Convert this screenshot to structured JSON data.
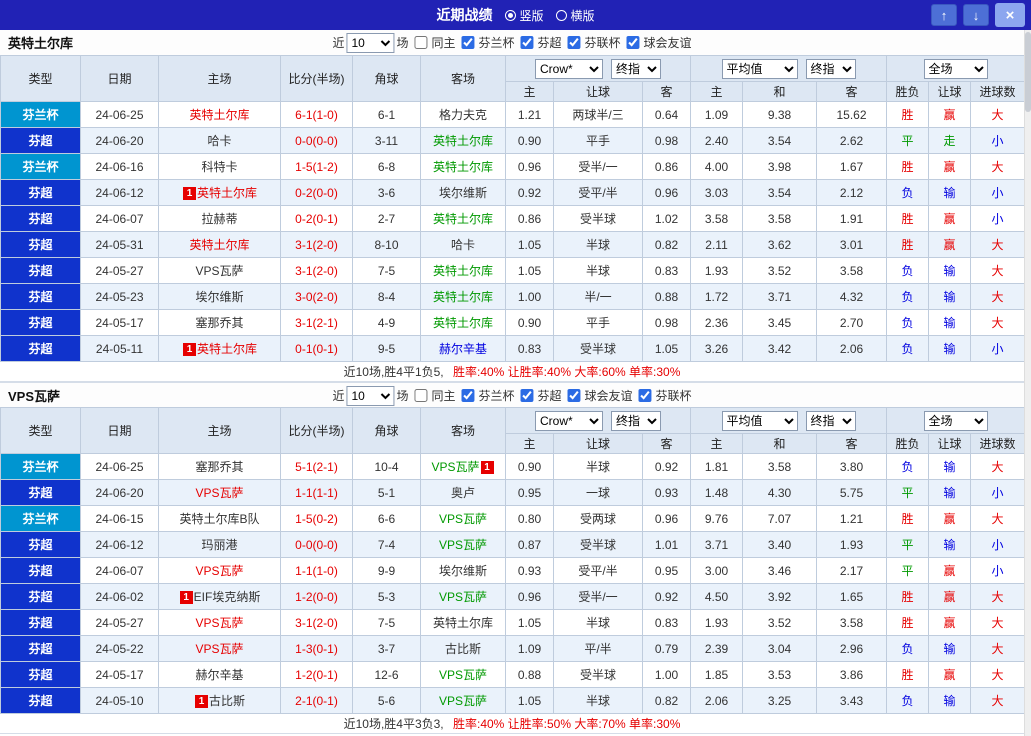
{
  "titlebar": {
    "title": "近期战绩",
    "vertical_label": "竖版",
    "horizontal_label": "横版",
    "vertical_selected": true,
    "up_icon": "↑",
    "down_icon": "↓",
    "close_icon": "×"
  },
  "filter_labels": {
    "near": "近",
    "matches": "场",
    "same_home": "同主"
  },
  "table_headers": {
    "type": "类型",
    "date": "日期",
    "home": "主场",
    "score": "比分(半场)",
    "corners": "角球",
    "away": "客场",
    "odds_home": "主",
    "handicap": "让球",
    "odds_away": "客",
    "avg_home": "主",
    "avg_draw": "和",
    "avg_away": "客",
    "result": "胜负",
    "handicap_result": "让球",
    "goals": "进球数"
  },
  "colors": {
    "titlebar_bg": "#2122b5",
    "leagues": {
      "芬兰杯": "#0095d0",
      "芬超": "#1033cc"
    },
    "text": {
      "red": "#e60000",
      "green": "#009900",
      "blue": "#0000e0",
      "black": "#333333"
    }
  },
  "sections": [
    {
      "team": "英特土尔库",
      "selects": {
        "count": "10",
        "provider": "Crow*",
        "provider_stage": "终指",
        "avg": "平均值",
        "avg_stage": "终指",
        "scope": "全场"
      },
      "same_home_checked": false,
      "filters": [
        {
          "label": "芬兰杯",
          "checked": true
        },
        {
          "label": "芬超",
          "checked": true
        },
        {
          "label": "芬联杯",
          "checked": true
        },
        {
          "label": "球会友谊",
          "checked": true
        }
      ],
      "rows": [
        {
          "league": "芬兰杯",
          "date": "24-06-25",
          "home": {
            "name": "英特土尔库",
            "color": "red"
          },
          "score": "6-1(1-0)",
          "corners": "6-1",
          "away": {
            "name": "格力夫克",
            "color": "black"
          },
          "odds": [
            "1.21",
            "两球半/三",
            "0.64"
          ],
          "avg": [
            "1.09",
            "9.38",
            "15.62"
          ],
          "results": [
            [
              "胜",
              "red"
            ],
            [
              "赢",
              "red"
            ],
            [
              "大",
              "red"
            ]
          ]
        },
        {
          "league": "芬超",
          "date": "24-06-20",
          "home": {
            "name": "哈卡",
            "color": "black"
          },
          "score": "0-0(0-0)",
          "corners": "3-11",
          "away": {
            "name": "英特土尔库",
            "color": "green"
          },
          "odds": [
            "0.90",
            "平手",
            "0.98"
          ],
          "avg": [
            "2.40",
            "3.54",
            "2.62"
          ],
          "results": [
            [
              "平",
              "green"
            ],
            [
              "走",
              "green"
            ],
            [
              "小",
              "blue"
            ]
          ]
        },
        {
          "league": "芬兰杯",
          "date": "24-06-16",
          "home": {
            "name": "科特卡",
            "color": "black"
          },
          "score": "1-5(1-2)",
          "corners": "6-8",
          "away": {
            "name": "英特土尔库",
            "color": "green"
          },
          "odds": [
            "0.96",
            "受半/一",
            "0.86"
          ],
          "avg": [
            "4.00",
            "3.98",
            "1.67"
          ],
          "results": [
            [
              "胜",
              "red"
            ],
            [
              "赢",
              "red"
            ],
            [
              "大",
              "red"
            ]
          ]
        },
        {
          "league": "芬超",
          "date": "24-06-12",
          "home": {
            "name": "英特土尔库",
            "color": "red",
            "badge": "1"
          },
          "score": "0-2(0-0)",
          "corners": "3-6",
          "away": {
            "name": "埃尔维斯",
            "color": "black"
          },
          "odds": [
            "0.92",
            "受平/半",
            "0.96"
          ],
          "avg": [
            "3.03",
            "3.54",
            "2.12"
          ],
          "results": [
            [
              "负",
              "blue"
            ],
            [
              "输",
              "blue"
            ],
            [
              "小",
              "blue"
            ]
          ]
        },
        {
          "league": "芬超",
          "date": "24-06-07",
          "home": {
            "name": "拉赫蒂",
            "color": "black"
          },
          "score": "0-2(0-1)",
          "corners": "2-7",
          "away": {
            "name": "英特土尔库",
            "color": "green"
          },
          "odds": [
            "0.86",
            "受半球",
            "1.02"
          ],
          "avg": [
            "3.58",
            "3.58",
            "1.91"
          ],
          "results": [
            [
              "胜",
              "red"
            ],
            [
              "赢",
              "red"
            ],
            [
              "小",
              "blue"
            ]
          ]
        },
        {
          "league": "芬超",
          "date": "24-05-31",
          "home": {
            "name": "英特土尔库",
            "color": "red"
          },
          "score": "3-1(2-0)",
          "corners": "8-10",
          "away": {
            "name": "哈卡",
            "color": "black"
          },
          "odds": [
            "1.05",
            "半球",
            "0.82"
          ],
          "avg": [
            "2.11",
            "3.62",
            "3.01"
          ],
          "results": [
            [
              "胜",
              "red"
            ],
            [
              "赢",
              "red"
            ],
            [
              "大",
              "red"
            ]
          ]
        },
        {
          "league": "芬超",
          "date": "24-05-27",
          "home": {
            "name": "VPS瓦萨",
            "color": "black"
          },
          "score": "3-1(2-0)",
          "corners": "7-5",
          "away": {
            "name": "英特土尔库",
            "color": "green"
          },
          "odds": [
            "1.05",
            "半球",
            "0.83"
          ],
          "avg": [
            "1.93",
            "3.52",
            "3.58"
          ],
          "results": [
            [
              "负",
              "blue"
            ],
            [
              "输",
              "blue"
            ],
            [
              "大",
              "red"
            ]
          ]
        },
        {
          "league": "芬超",
          "date": "24-05-23",
          "home": {
            "name": "埃尔维斯",
            "color": "black"
          },
          "score": "3-0(2-0)",
          "corners": "8-4",
          "away": {
            "name": "英特土尔库",
            "color": "green"
          },
          "odds": [
            "1.00",
            "半/一",
            "0.88"
          ],
          "avg": [
            "1.72",
            "3.71",
            "4.32"
          ],
          "results": [
            [
              "负",
              "blue"
            ],
            [
              "输",
              "blue"
            ],
            [
              "大",
              "red"
            ]
          ]
        },
        {
          "league": "芬超",
          "date": "24-05-17",
          "home": {
            "name": "塞那乔其",
            "color": "black"
          },
          "score": "3-1(2-1)",
          "corners": "4-9",
          "away": {
            "name": "英特土尔库",
            "color": "green"
          },
          "odds": [
            "0.90",
            "平手",
            "0.98"
          ],
          "avg": [
            "2.36",
            "3.45",
            "2.70"
          ],
          "results": [
            [
              "负",
              "blue"
            ],
            [
              "输",
              "blue"
            ],
            [
              "大",
              "red"
            ]
          ]
        },
        {
          "league": "芬超",
          "date": "24-05-11",
          "home": {
            "name": "英特土尔库",
            "color": "red",
            "badge": "1"
          },
          "score": "0-1(0-1)",
          "corners": "9-5",
          "away": {
            "name": "赫尔辛基",
            "color": "blue"
          },
          "odds": [
            "0.83",
            "受半球",
            "1.05"
          ],
          "avg": [
            "3.26",
            "3.42",
            "2.06"
          ],
          "results": [
            [
              "负",
              "blue"
            ],
            [
              "输",
              "blue"
            ],
            [
              "小",
              "blue"
            ]
          ]
        }
      ],
      "summary_prefix": "近10场,胜4平1负5,",
      "summary_stats": "胜率:40% 让胜率:40% 大率:60% 单率:30%"
    },
    {
      "team": "VPS瓦萨",
      "selects": {
        "count": "10",
        "provider": "Crow*",
        "provider_stage": "终指",
        "avg": "平均值",
        "avg_stage": "终指",
        "scope": "全场"
      },
      "same_home_checked": false,
      "filters": [
        {
          "label": "芬兰杯",
          "checked": true
        },
        {
          "label": "芬超",
          "checked": true
        },
        {
          "label": "球会友谊",
          "checked": true
        },
        {
          "label": "芬联杯",
          "checked": true
        }
      ],
      "rows": [
        {
          "league": "芬兰杯",
          "date": "24-06-25",
          "home": {
            "name": "塞那乔其",
            "color": "black"
          },
          "score": "5-1(2-1)",
          "corners": "10-4",
          "away": {
            "name": "VPS瓦萨",
            "color": "green",
            "badge": "1",
            "badge_after": true
          },
          "odds": [
            "0.90",
            "半球",
            "0.92"
          ],
          "avg": [
            "1.81",
            "3.58",
            "3.80"
          ],
          "results": [
            [
              "负",
              "blue"
            ],
            [
              "输",
              "blue"
            ],
            [
              "大",
              "red"
            ]
          ]
        },
        {
          "league": "芬超",
          "date": "24-06-20",
          "home": {
            "name": "VPS瓦萨",
            "color": "red"
          },
          "score": "1-1(1-1)",
          "corners": "5-1",
          "away": {
            "name": "奥卢",
            "color": "black"
          },
          "odds": [
            "0.95",
            "一球",
            "0.93"
          ],
          "avg": [
            "1.48",
            "4.30",
            "5.75"
          ],
          "results": [
            [
              "平",
              "green"
            ],
            [
              "输",
              "blue"
            ],
            [
              "小",
              "blue"
            ]
          ]
        },
        {
          "league": "芬兰杯",
          "date": "24-06-15",
          "home": {
            "name": "英特土尔库B队",
            "color": "black"
          },
          "score": "1-5(0-2)",
          "corners": "6-6",
          "away": {
            "name": "VPS瓦萨",
            "color": "green"
          },
          "odds": [
            "0.80",
            "受两球",
            "0.96"
          ],
          "avg": [
            "9.76",
            "7.07",
            "1.21"
          ],
          "results": [
            [
              "胜",
              "red"
            ],
            [
              "赢",
              "red"
            ],
            [
              "大",
              "red"
            ]
          ]
        },
        {
          "league": "芬超",
          "date": "24-06-12",
          "home": {
            "name": "玛丽港",
            "color": "black"
          },
          "score": "0-0(0-0)",
          "corners": "7-4",
          "away": {
            "name": "VPS瓦萨",
            "color": "green"
          },
          "odds": [
            "0.87",
            "受半球",
            "1.01"
          ],
          "avg": [
            "3.71",
            "3.40",
            "1.93"
          ],
          "results": [
            [
              "平",
              "green"
            ],
            [
              "输",
              "blue"
            ],
            [
              "小",
              "blue"
            ]
          ]
        },
        {
          "league": "芬超",
          "date": "24-06-07",
          "home": {
            "name": "VPS瓦萨",
            "color": "red"
          },
          "score": "1-1(1-0)",
          "corners": "9-9",
          "away": {
            "name": "埃尔维斯",
            "color": "black"
          },
          "odds": [
            "0.93",
            "受平/半",
            "0.95"
          ],
          "avg": [
            "3.00",
            "3.46",
            "2.17"
          ],
          "results": [
            [
              "平",
              "green"
            ],
            [
              "赢",
              "red"
            ],
            [
              "小",
              "blue"
            ]
          ]
        },
        {
          "league": "芬超",
          "date": "24-06-02",
          "home": {
            "name": "EIF埃克纳斯",
            "color": "black",
            "badge": "1"
          },
          "score": "1-2(0-0)",
          "corners": "5-3",
          "away": {
            "name": "VPS瓦萨",
            "color": "green"
          },
          "odds": [
            "0.96",
            "受半/一",
            "0.92"
          ],
          "avg": [
            "4.50",
            "3.92",
            "1.65"
          ],
          "results": [
            [
              "胜",
              "red"
            ],
            [
              "赢",
              "red"
            ],
            [
              "大",
              "red"
            ]
          ]
        },
        {
          "league": "芬超",
          "date": "24-05-27",
          "home": {
            "name": "VPS瓦萨",
            "color": "red"
          },
          "score": "3-1(2-0)",
          "corners": "7-5",
          "away": {
            "name": "英特土尔库",
            "color": "black"
          },
          "odds": [
            "1.05",
            "半球",
            "0.83"
          ],
          "avg": [
            "1.93",
            "3.52",
            "3.58"
          ],
          "results": [
            [
              "胜",
              "red"
            ],
            [
              "赢",
              "red"
            ],
            [
              "大",
              "red"
            ]
          ]
        },
        {
          "league": "芬超",
          "date": "24-05-22",
          "home": {
            "name": "VPS瓦萨",
            "color": "red"
          },
          "score": "1-3(0-1)",
          "corners": "3-7",
          "away": {
            "name": "古比斯",
            "color": "black"
          },
          "odds": [
            "1.09",
            "平/半",
            "0.79"
          ],
          "avg": [
            "2.39",
            "3.04",
            "2.96"
          ],
          "results": [
            [
              "负",
              "blue"
            ],
            [
              "输",
              "blue"
            ],
            [
              "大",
              "red"
            ]
          ]
        },
        {
          "league": "芬超",
          "date": "24-05-17",
          "home": {
            "name": "赫尔辛基",
            "color": "black"
          },
          "score": "1-2(0-1)",
          "corners": "12-6",
          "away": {
            "name": "VPS瓦萨",
            "color": "green"
          },
          "odds": [
            "0.88",
            "受半球",
            "1.00"
          ],
          "avg": [
            "1.85",
            "3.53",
            "3.86"
          ],
          "results": [
            [
              "胜",
              "red"
            ],
            [
              "赢",
              "red"
            ],
            [
              "大",
              "red"
            ]
          ]
        },
        {
          "league": "芬超",
          "date": "24-05-10",
          "home": {
            "name": "古比斯",
            "color": "black",
            "badge": "1"
          },
          "score": "2-1(0-1)",
          "corners": "5-6",
          "away": {
            "name": "VPS瓦萨",
            "color": "green"
          },
          "odds": [
            "1.05",
            "半球",
            "0.82"
          ],
          "avg": [
            "2.06",
            "3.25",
            "3.43"
          ],
          "results": [
            [
              "负",
              "blue"
            ],
            [
              "输",
              "blue"
            ],
            [
              "大",
              "red"
            ]
          ]
        }
      ],
      "summary_prefix": "近10场,胜4平3负3,",
      "summary_stats": "胜率:40% 让胜率:50% 大率:70% 单率:30%"
    }
  ]
}
